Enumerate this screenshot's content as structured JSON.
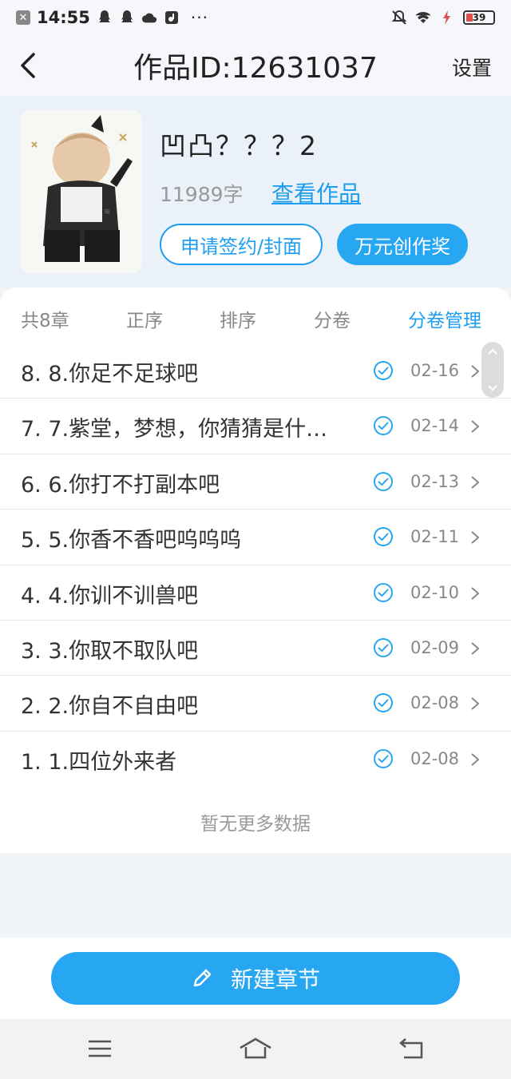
{
  "status_bar": {
    "time": "14:55",
    "dots": "···",
    "battery": "39"
  },
  "header": {
    "title": "作品ID:12631037",
    "settings": "设置"
  },
  "work": {
    "title": "凹凸？？？2",
    "word_count": "11989字",
    "view_link": "查看作品",
    "sign_button": "申请签约/封面",
    "prize_button": "万元创作奖"
  },
  "tabs": [
    {
      "label": "共8章"
    },
    {
      "label": "正序"
    },
    {
      "label": "排序"
    },
    {
      "label": "分卷"
    },
    {
      "label": "分卷管理"
    }
  ],
  "chapters": [
    {
      "name": "8. 8.你足不足球吧",
      "date": "02-16"
    },
    {
      "name": "7. 7.紫堂，梦想，你猜猜是什…",
      "date": "02-14"
    },
    {
      "name": "6. 6.你打不打副本吧",
      "date": "02-13"
    },
    {
      "name": "5. 5.你香不香吧呜呜呜",
      "date": "02-11"
    },
    {
      "name": "4. 4.你训不训兽吧",
      "date": "02-10"
    },
    {
      "name": "3. 3.你取不取队吧",
      "date": "02-09"
    },
    {
      "name": "2. 2.你自不自由吧",
      "date": "02-08"
    },
    {
      "name": "1. 1.四位外来者",
      "date": "02-08"
    }
  ],
  "list_footer": "暂无更多数据",
  "new_chapter_button": "新建章节",
  "colors": {
    "accent": "#27a6f2",
    "link": "#1e9ef0"
  },
  "icons": {
    "back": "chevron-left-icon",
    "check": "check-circle-icon",
    "chevron": "chevron-right-icon",
    "pencil": "pencil-icon",
    "menu": "menu-icon",
    "home": "home-icon",
    "back_nav": "return-icon"
  }
}
